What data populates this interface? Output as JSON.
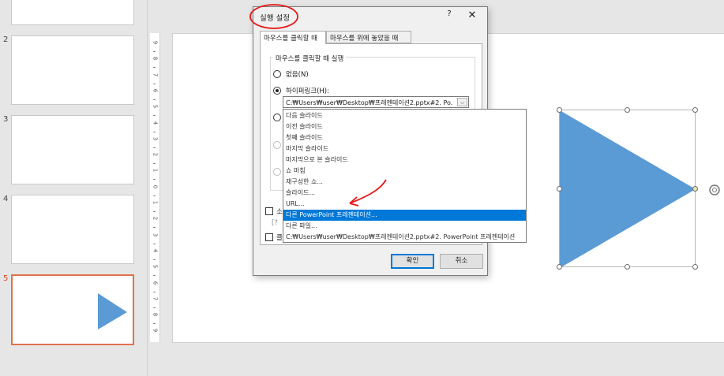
{
  "thumbnails": [
    {
      "num": "",
      "selected": false
    },
    {
      "num": "2",
      "selected": false
    },
    {
      "num": "3",
      "selected": false
    },
    {
      "num": "4",
      "selected": false
    },
    {
      "num": "5",
      "selected": true
    }
  ],
  "ruler": {
    "labels": [
      "9",
      "8",
      "7",
      "6",
      "5",
      "4",
      "3",
      "2",
      "1",
      "0",
      "1",
      "2",
      "3",
      "4",
      "5",
      "6",
      "7",
      "8",
      "9"
    ]
  },
  "dialog": {
    "title": "실행 설정",
    "help": "?",
    "close": "✕",
    "tabs": [
      "마우스를 클릭할 때",
      "마우스를 위에 놓았을 때"
    ],
    "group_label": "마우스를 클릭할 때 실행",
    "options": {
      "none": "없음(N)",
      "hyperlink": "하이퍼링크(H):"
    },
    "hyperlink_value": "C:₩Users₩user₩Desktop₩프레젠테이션2.pptx#2. Po...",
    "partial_1": "소",
    "partial_2": "클",
    "partial_3": "[?",
    "ok": "확인",
    "cancel": "취소"
  },
  "dropdown_items": [
    "다음 슬라이드",
    "이전 슬라이드",
    "첫째 슬라이드",
    "마지막 슬라이드",
    "마지막으로 본 슬라이드",
    "쇼 마침",
    "재구성한 쇼...",
    "슬라이드...",
    "URL...",
    "다른 PowerPoint 프레젠테이션...",
    "다른 파일...",
    "C:₩Users₩user₩Desktop₩프레젠테이션2.pptx#2. PowerPoint 프레젠테이션"
  ],
  "dropdown_highlighted": 9,
  "colors": {
    "accent": "#0078d7",
    "shape": "#5b9bd5",
    "selected_thumb": "#e2714e",
    "annotation": "#e51919"
  }
}
